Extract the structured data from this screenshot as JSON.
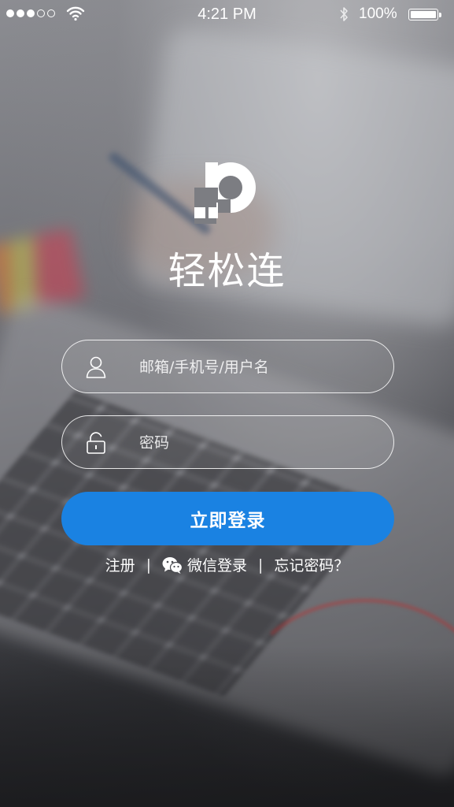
{
  "status_bar": {
    "signal_filled": 3,
    "signal_total": 5,
    "time": "4:21 PM",
    "battery_percent": "100%",
    "icons": [
      "signal-dots-icon",
      "wifi-icon",
      "bluetooth-icon",
      "battery-icon"
    ]
  },
  "app": {
    "name": "轻松连",
    "logo_icon": "app-logo-icon"
  },
  "form": {
    "username_placeholder": "邮箱/手机号/用户名",
    "username_value": "",
    "username_icon": "user-icon",
    "password_placeholder": "密码",
    "password_value": "",
    "password_icon": "unlock-icon",
    "login_label": "立即登录"
  },
  "links": {
    "register_label": "注册",
    "separator": "|",
    "wechat_login_label": "微信登录",
    "wechat_icon": "wechat-icon",
    "forgot_password_label": "忘记密码？"
  },
  "colors": {
    "primary_button": "#1a82e2",
    "text": "#ffffff"
  }
}
